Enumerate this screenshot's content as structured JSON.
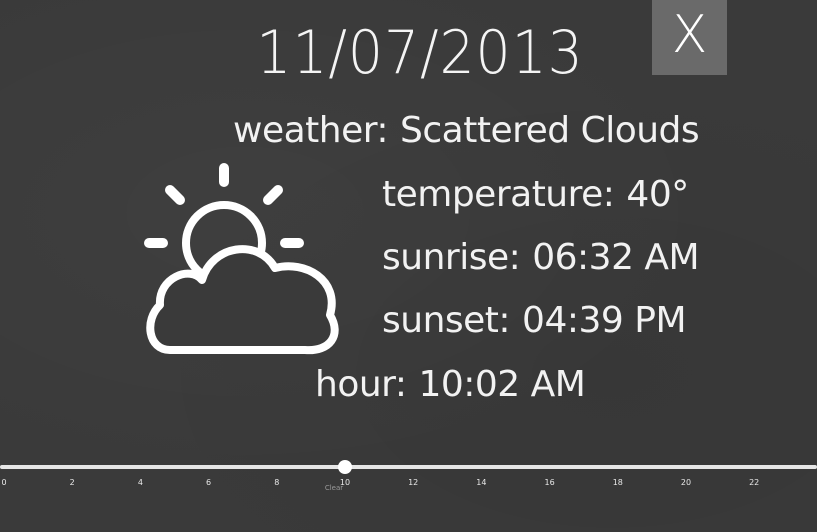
{
  "date": "11/07/2013",
  "close_button": {
    "label": "X"
  },
  "weather": {
    "label": "weather:",
    "value": "Scattered Clouds",
    "icon": "partly-cloudy-icon"
  },
  "temperature": {
    "label": "temperature:",
    "value": "40°"
  },
  "sunrise": {
    "label": "sunrise:",
    "value": "06:32 AM"
  },
  "sunset": {
    "label": "sunset:",
    "value": "04:39 PM"
  },
  "hour": {
    "label": "hour:",
    "value": "10:02 AM"
  },
  "slider": {
    "min": 0,
    "max": 24,
    "value": 10,
    "ticks": [
      "0",
      "2",
      "4",
      "6",
      "8",
      "10",
      "12",
      "14",
      "16",
      "18",
      "20",
      "22"
    ],
    "thumb_caption": "Clear"
  },
  "colors": {
    "background": "#3a3a3a",
    "close_button_bg": "#6a6a6a",
    "text": "#ffffff"
  }
}
